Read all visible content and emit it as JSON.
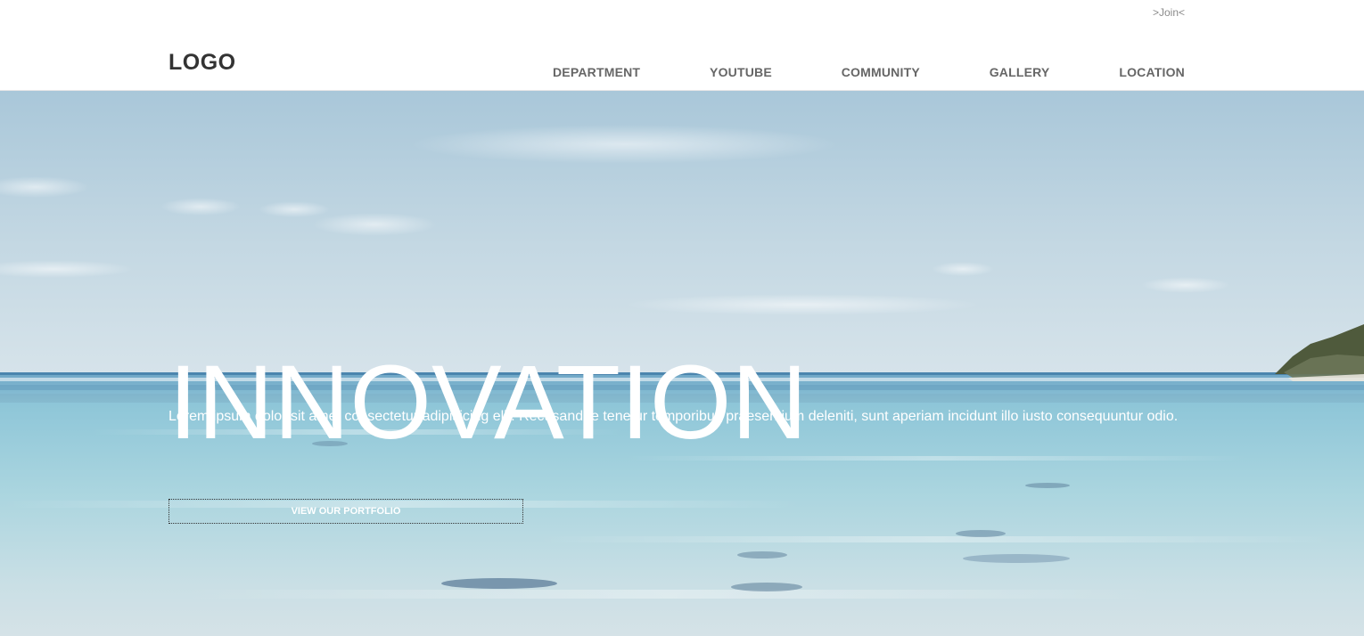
{
  "header": {
    "join_link": ">Join<",
    "logo": "LOGO",
    "nav": [
      {
        "label": "DEPARTMENT"
      },
      {
        "label": "YOUTUBE"
      },
      {
        "label": "COMMUNITY"
      },
      {
        "label": "GALLERY"
      },
      {
        "label": "LOCATION"
      }
    ]
  },
  "hero": {
    "title": "INNOVATION",
    "description": "Lorem ipsum dolor sit amet consectetur adipisicing elit. Recusandae tenetur temporibus praesentium deleniti, sunt aperiam incidunt illo iusto consequuntur odio.",
    "button_label": "VIEW OUR PORTFOLIO"
  },
  "colors": {
    "header_bg": "#ffffff",
    "nav_text": "#666666",
    "logo_text": "#333333",
    "hero_text": "#ffffff"
  }
}
